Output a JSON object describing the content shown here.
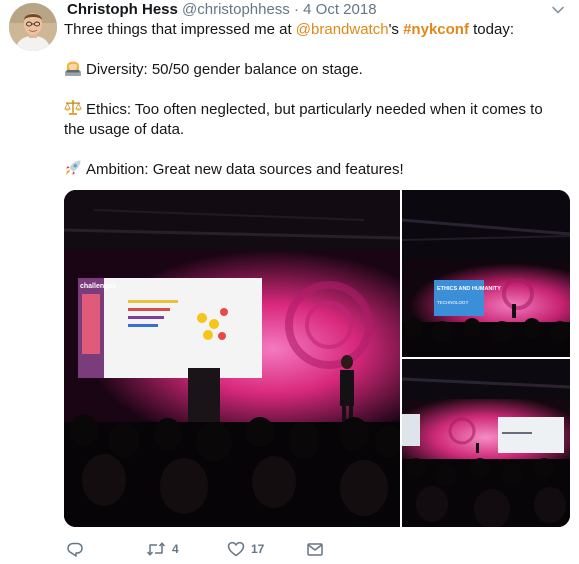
{
  "tweet": {
    "author_name": "Christoph Hess",
    "handle": "@christophhess",
    "separator": "·",
    "date": "4 Oct 2018",
    "text": {
      "intro_before": "Three things that impressed me at ",
      "mention": "@brandwatch",
      "intro_between": "'s ",
      "hashtag": "#nykconf",
      "intro_after": " today:",
      "line1": "Diversity: 50/50 gender balance on stage.",
      "line2": "Ethics: Too often neglected, but particularly needed when it comes to the usage of data.",
      "line3": "Ambition: Great new data sources and features!"
    },
    "emojis": [
      "woman-technologist-emoji",
      "scales-emoji",
      "rocket-emoji"
    ],
    "media": {
      "main_screen_heading": "challenges",
      "side_screen_heading": "ETHICS AND HUMANITY",
      "side_screen_subheading": "TECHNOLOGY"
    },
    "actions": {
      "reply_count": "",
      "retweet_count": "4",
      "like_count": "17"
    }
  },
  "colors": {
    "link": "#e0891a",
    "muted": "#657786",
    "stage_pink": "#d9297d"
  }
}
